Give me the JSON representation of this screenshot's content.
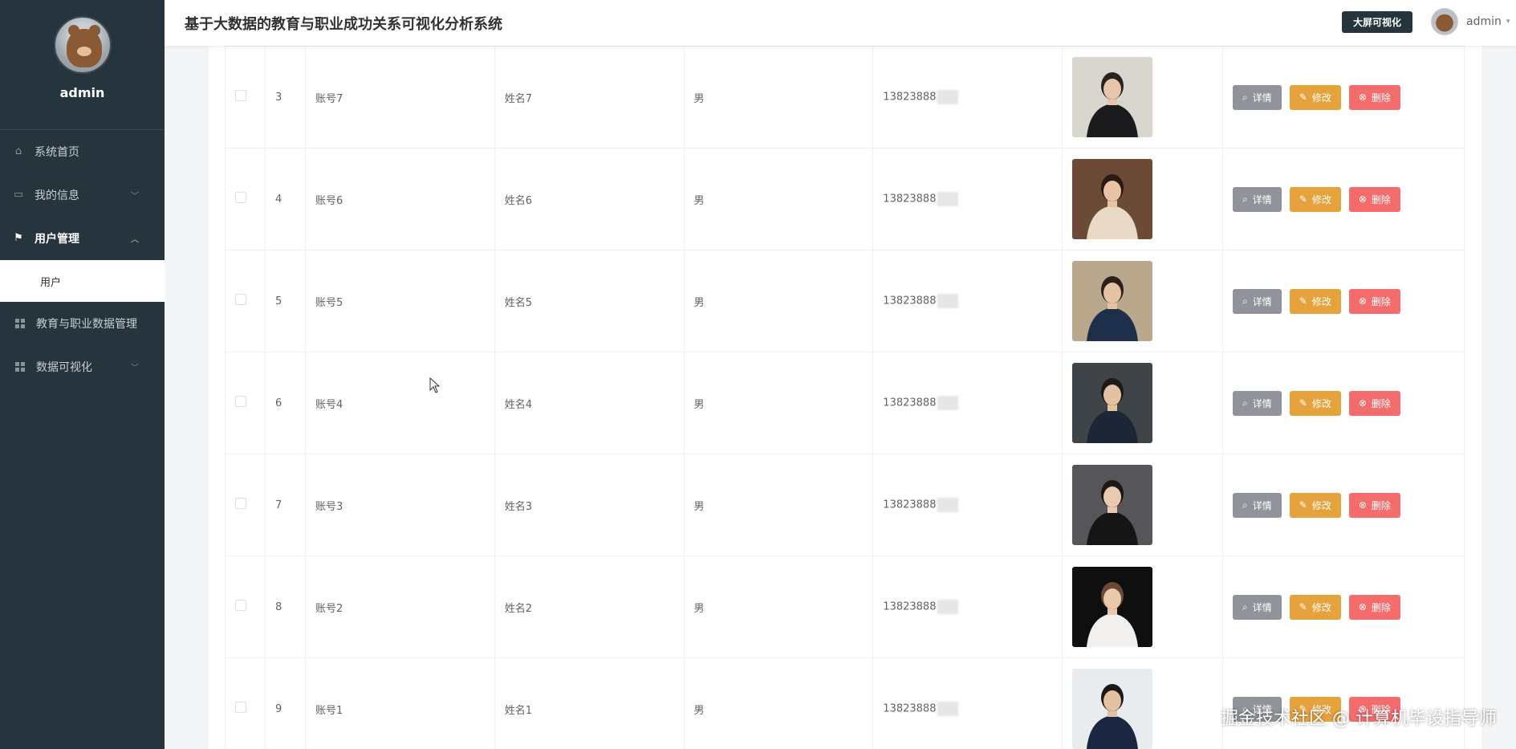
{
  "sidebar": {
    "username": "admin",
    "menu": [
      {
        "label": "系统首页",
        "icon": "home-icon"
      },
      {
        "label": "我的信息",
        "icon": "card-icon"
      },
      {
        "label": "用户管理",
        "icon": "flag-icon"
      },
      {
        "label": "教育与职业数据管理",
        "icon": "grid-icon"
      },
      {
        "label": "数据可视化",
        "icon": "grid-icon"
      }
    ],
    "submenu_user": "用户"
  },
  "header": {
    "title": "基于大数据的教育与职业成功关系可视化分析系统",
    "bigscreen_label": "大屏可视化",
    "username": "admin"
  },
  "table": {
    "rows": [
      {
        "index": "3",
        "account": "账号7",
        "name": "姓名7",
        "gender": "男",
        "phone": "13823888"
      },
      {
        "index": "4",
        "account": "账号6",
        "name": "姓名6",
        "gender": "男",
        "phone": "13823888"
      },
      {
        "index": "5",
        "account": "账号5",
        "name": "姓名5",
        "gender": "男",
        "phone": "13823888"
      },
      {
        "index": "6",
        "account": "账号4",
        "name": "姓名4",
        "gender": "男",
        "phone": "13823888"
      },
      {
        "index": "7",
        "account": "账号3",
        "name": "姓名3",
        "gender": "男",
        "phone": "13823888"
      },
      {
        "index": "8",
        "account": "账号2",
        "name": "姓名2",
        "gender": "男",
        "phone": "13823888"
      },
      {
        "index": "9",
        "account": "账号1",
        "name": "姓名1",
        "gender": "男",
        "phone": "13823888"
      }
    ],
    "actions": {
      "detail": "详情",
      "edit": "修改",
      "delete": "删除"
    }
  },
  "watermark": "掘金技术社区 @ 计算机毕设指导师",
  "colors": {
    "sidebar": "#26343e",
    "detail": "#909399",
    "edit": "#e6a23c",
    "delete": "#f56c6c"
  }
}
